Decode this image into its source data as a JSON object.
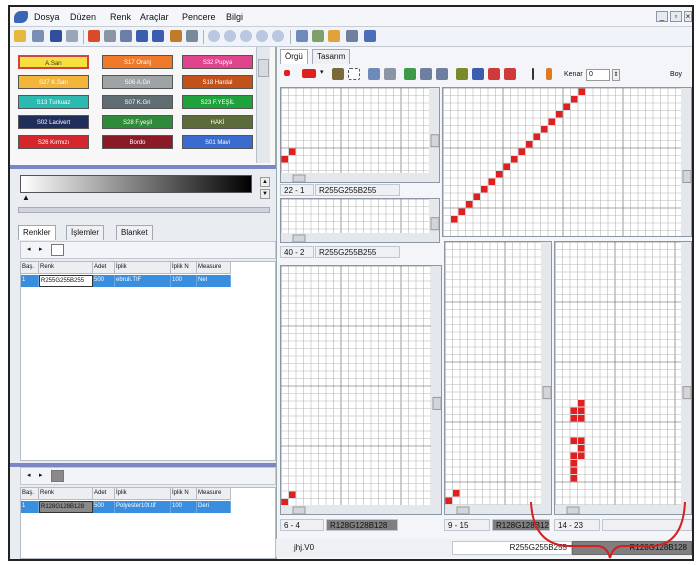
{
  "menu": [
    "Dosya",
    "Düzen",
    "Renk",
    "Araçlar",
    "Pencere",
    "Bilgi"
  ],
  "palette": [
    {
      "label": "A.Sarı",
      "color": "#f5e040",
      "text_color": "#333",
      "selected": true
    },
    {
      "label": "S17 Oranj",
      "color": "#f07a2a",
      "text_color": "#fff"
    },
    {
      "label": "S32 Pupya",
      "color": "#e0448c",
      "text_color": "#fff"
    },
    {
      "label": "S27 K.Sarı",
      "color": "#f2b53a",
      "text_color": "#fff"
    },
    {
      "label": "S06 A.Gri",
      "color": "#9ea3a6",
      "text_color": "#fff"
    },
    {
      "label": "S18 Hardal",
      "color": "#c3521a",
      "text_color": "#fff"
    },
    {
      "label": "S13 Turkuaz",
      "color": "#2bb9b0",
      "text_color": "#fff"
    },
    {
      "label": "S07 K.Gri",
      "color": "#5f6d73",
      "text_color": "#fff"
    },
    {
      "label": "S23 F.YEŞİL",
      "color": "#1fa23c",
      "text_color": "#fff"
    },
    {
      "label": "S02 Lacivert",
      "color": "#1f2e5a",
      "text_color": "#fff"
    },
    {
      "label": "S28 F.yeşil",
      "color": "#2f8a3a",
      "text_color": "#fff"
    },
    {
      "label": "HAKİ",
      "color": "#5c6b3a",
      "text_color": "#fff"
    },
    {
      "label": "S26 Kırmızı",
      "color": "#d4262b",
      "text_color": "#fff"
    },
    {
      "label": "Bordo",
      "color": "#8a1a26",
      "text_color": "#fff"
    },
    {
      "label": "S01 Mavi",
      "color": "#3a6ccf",
      "text_color": "#fff"
    }
  ],
  "left_tabs": [
    "Renkler",
    "İşlemler",
    "Blanket"
  ],
  "table_headers": [
    "Baş.",
    "Renk",
    "Adet",
    "İplik",
    "İplik N",
    "Measure"
  ],
  "table1_row": [
    "1",
    "R255G255B255",
    "500",
    "ebruli.TIF",
    "100",
    "Nel"
  ],
  "table2_row": [
    "1",
    "R128G128B128",
    "500",
    "Polyester10t.tif",
    "100",
    "Deri"
  ],
  "main_tabs": [
    "Örgü",
    "Tasarım"
  ],
  "kenar_label": "Kenar",
  "kenar_value": "0",
  "boy_label": "Boy",
  "panes": [
    {
      "coord": "22 - 1",
      "color": "R255G255B255"
    },
    {
      "coord": "40 - 2",
      "color": "R255G255B255"
    },
    {
      "coord": "6 - 4",
      "color": "R128G128B128"
    },
    {
      "coord": "9 - 15",
      "color": "R128G128B128"
    },
    {
      "coord": "14 - 23",
      "color": ""
    }
  ],
  "bottom_file": "jhj.V0",
  "bottom_color1": "R255G255B255",
  "bottom_color2": "R128G128B128",
  "accent": "#e02020"
}
